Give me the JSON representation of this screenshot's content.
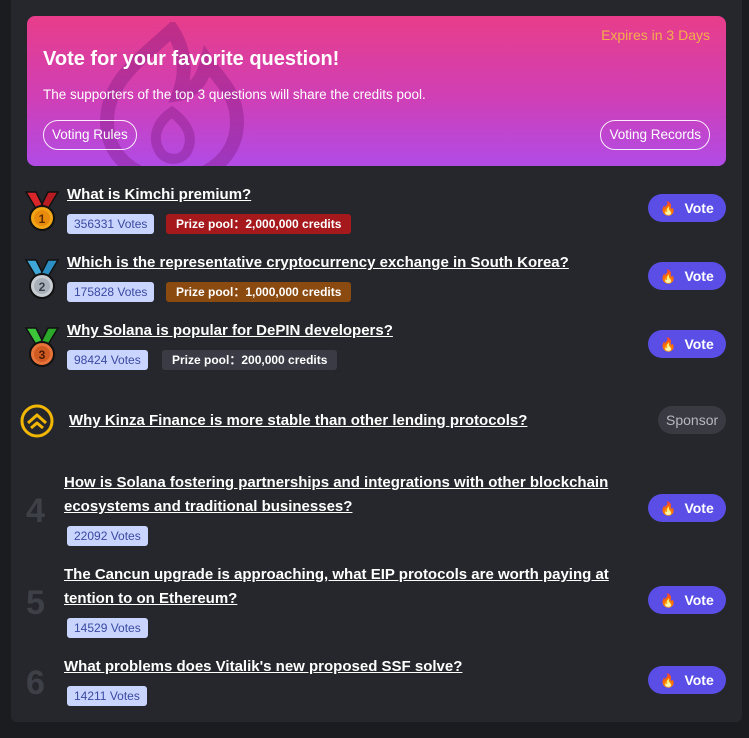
{
  "hero": {
    "expires": "Expires in 3 Days",
    "title": "Vote for your favorite question!",
    "subtitle": "The supporters of the top 3 questions will share the credits pool.",
    "rules_label": "Voting Rules",
    "records_label": "Voting Records"
  },
  "vote_label": "Vote",
  "top": [
    {
      "title": "What is Kimchi premium?",
      "votes": "356331 Votes",
      "prize": "Prize pool：2,000,000 credits"
    },
    {
      "title": "Which is the representative cryptocurrency exchange in South Korea?",
      "votes": "175828 Votes",
      "prize": "Prize pool：1,000,000 credits"
    },
    {
      "title": "Why Solana is popular for DePIN developers?",
      "votes": "98424 Votes",
      "prize": "Prize pool：200,000 credits"
    }
  ],
  "sponsor": {
    "title": "Why Kinza Finance is more stable than other lending protocols?",
    "badge": "Sponsor"
  },
  "rest": [
    {
      "rank": "4",
      "title_line1": "How is Solana fostering partnerships and integrations with other blockchain",
      "title_line2": "ecosystems and traditional businesses?",
      "votes": "22092 Votes"
    },
    {
      "rank": "5",
      "title_line1": "The Cancun upgrade is approaching, what EIP protocols are worth paying at",
      "title_line2": "tention to on Ethereum?",
      "votes": "14529 Votes"
    },
    {
      "rank": "6",
      "title_line1": "What problems does Vitalik's new proposed SSF solve?",
      "title_line2": "",
      "votes": "14211 Votes"
    }
  ],
  "colors": {
    "vote_button": "#5a4ee6",
    "votes_badge_bg": "#c9d4ff",
    "prize_gold": "#a5181c",
    "prize_silver": "#8b4a10",
    "prize_bronze": "#3a3b44",
    "expires": "#f3b04a"
  }
}
